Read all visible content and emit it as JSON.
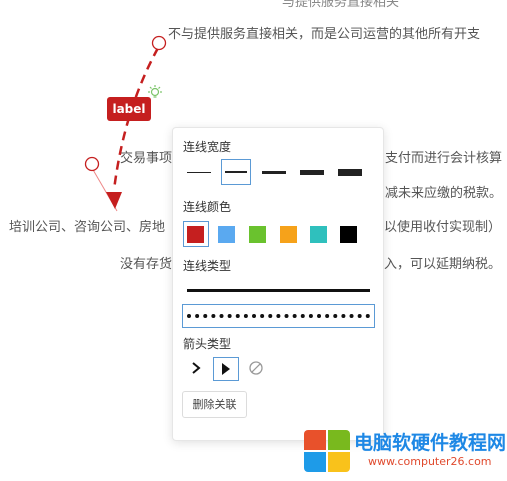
{
  "background_text": {
    "t0": "与提供服务直接相关",
    "t1": "不与提供服务直接相关，而是公司运营的其他所有开支",
    "t2": "交易事项",
    "t3": "支付而进行会计核算",
    "t4": "减未来应缴的税款。",
    "t5": "培训公司、咨询公司、房地",
    "t6": "以使用收付实现制）",
    "t7": "没有存货",
    "t8": "入，可以延期纳税。"
  },
  "connector": {
    "label": "label",
    "color": "#c51f1f"
  },
  "panel": {
    "line_width_title": "连线宽度",
    "line_color_title": "连线颜色",
    "line_type_title": "连线类型",
    "arrow_type_title": "箭头类型",
    "delete_label": "删除关联",
    "colors": [
      "#c51f1f",
      "#5aa9f0",
      "#6ac22e",
      "#f6a21a",
      "#2fc0bd",
      "#000000"
    ],
    "selected_width_index": 1,
    "selected_color_index": 0,
    "selected_type": "dotted",
    "selected_arrow_index": 1
  },
  "watermark": {
    "name": "电脑软硬件教程网",
    "url": "www.computer26.com"
  }
}
